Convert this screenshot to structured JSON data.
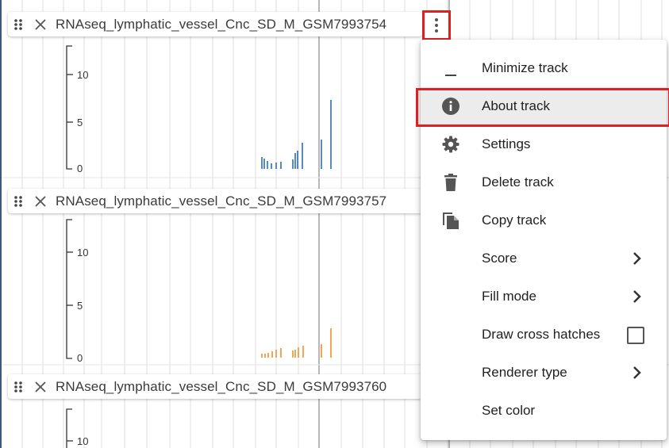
{
  "tracks": [
    {
      "name": "RNAseq_lymphatic_vessel_Cnc_SD_M_GSM7993754",
      "color": "#2c6ea8",
      "ticks": [
        "10",
        "5",
        "0"
      ],
      "tick_values": [
        10,
        5,
        0
      ]
    },
    {
      "name": "RNAseq_lymphatic_vessel_Cnc_SD_M_GSM7993757",
      "color": "#f28e2b",
      "ticks": [
        "10",
        "5",
        "0"
      ],
      "tick_values": [
        10,
        5,
        0
      ]
    },
    {
      "name": "RNAseq_lymphatic_vessel_Cnc_SD_M_GSM7993760",
      "color": "#2c6ea8",
      "ticks": [
        "10"
      ],
      "tick_values": [
        10
      ]
    }
  ],
  "menu": {
    "items": [
      {
        "label": "Minimize track",
        "icon": "minimize-icon"
      },
      {
        "label": "About track",
        "icon": "info-icon"
      },
      {
        "label": "Settings",
        "icon": "gear-icon"
      },
      {
        "label": "Delete track",
        "icon": "trash-icon"
      },
      {
        "label": "Copy track",
        "icon": "copy-icon"
      },
      {
        "label": "Score",
        "icon": "",
        "submenu": true
      },
      {
        "label": "Fill mode",
        "icon": "",
        "submenu": true
      },
      {
        "label": "Draw cross hatches",
        "icon": "",
        "checkbox": true,
        "checked": false
      },
      {
        "label": "Renderer type",
        "icon": "",
        "submenu": true
      },
      {
        "label": "Set color",
        "icon": ""
      }
    ]
  },
  "colors": {
    "highlight": "#e02020",
    "series_blue": "#2c6ea8",
    "series_orange": "#f28e2b"
  }
}
